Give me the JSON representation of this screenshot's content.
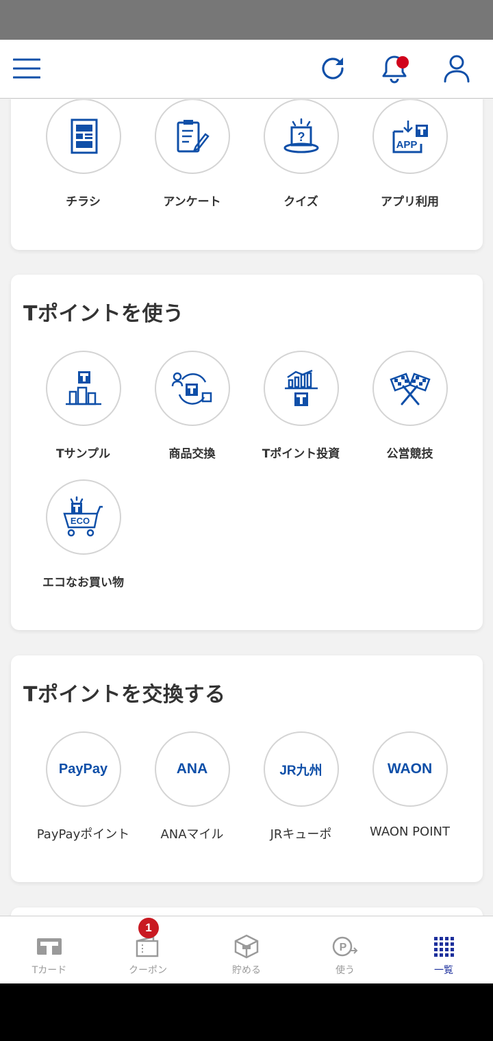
{
  "earn_section": {
    "items": [
      {
        "label": "チラシ",
        "icon": "flyer-icon"
      },
      {
        "label": "アンケート",
        "icon": "survey-icon"
      },
      {
        "label": "クイズ",
        "icon": "quiz-icon"
      },
      {
        "label": "アプリ利用",
        "icon": "app-usage-icon"
      }
    ]
  },
  "use_section": {
    "title": "Tポイントを使う",
    "items": [
      {
        "label": "Tサンプル",
        "icon": "t-sample-icon"
      },
      {
        "label": "商品交換",
        "icon": "product-exchange-icon"
      },
      {
        "label": "Tポイント投資",
        "icon": "investment-icon"
      },
      {
        "label": "公営競技",
        "icon": "racing-flags-icon"
      },
      {
        "label": "エコなお買い物",
        "icon": "eco-cart-icon"
      }
    ]
  },
  "exchange_section": {
    "title": "Tポイントを交換する",
    "items": [
      {
        "logo": "PayPay",
        "label": "PayPayポイント"
      },
      {
        "logo": "ANA",
        "label": "ANAマイル"
      },
      {
        "logo": "JR九州",
        "label": "JRキューポ"
      },
      {
        "logo": "WAON",
        "label": "WAON POINT"
      }
    ]
  },
  "tabs": [
    {
      "label": "Tカード",
      "icon": "t-card-icon"
    },
    {
      "label": "クーポン",
      "icon": "coupon-wallet-icon",
      "badge": "1"
    },
    {
      "label": "貯める",
      "icon": "save-box-icon"
    },
    {
      "label": "使う",
      "icon": "use-point-icon"
    },
    {
      "label": "一覧",
      "icon": "grid-icon",
      "active": true
    }
  ],
  "colors": {
    "accent": "#0f4fa8",
    "active_tab": "#1c2f9c",
    "badge": "#c91a22",
    "notification_dot": "#d0021b"
  }
}
